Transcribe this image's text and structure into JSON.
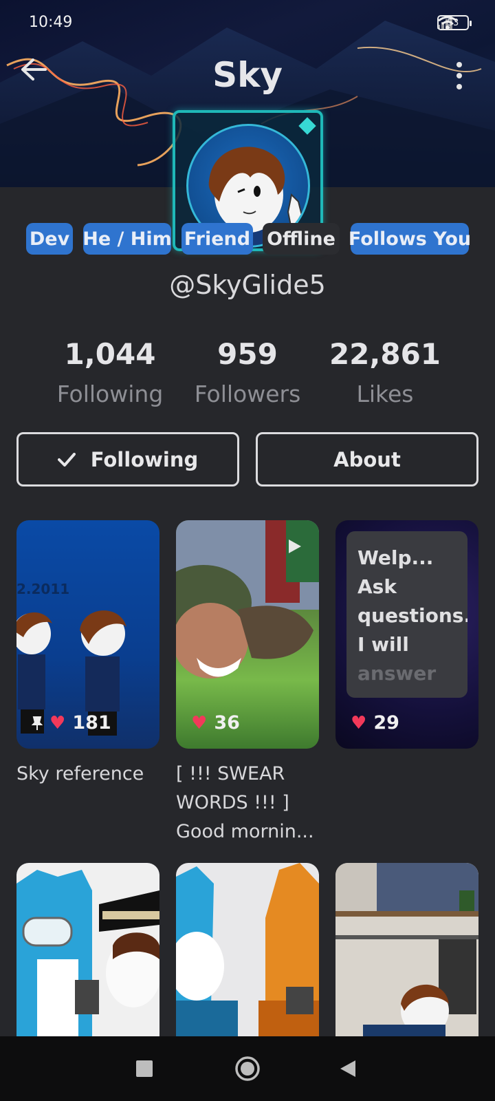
{
  "status_bar": {
    "time": "10:49",
    "battery": "53"
  },
  "header": {
    "title": "Sky"
  },
  "badges": [
    {
      "label": "Dev",
      "style": "blue"
    },
    {
      "label": "He / Him",
      "style": "blue"
    },
    {
      "label": "Friend",
      "style": "blue"
    },
    {
      "label": "Offline",
      "style": "dark"
    },
    {
      "label": "Follows You",
      "style": "blue"
    }
  ],
  "profile": {
    "handle": "@SkyGlide5"
  },
  "stats": [
    {
      "value": "1,044",
      "label": "Following"
    },
    {
      "value": "959",
      "label": "Followers"
    },
    {
      "value": "22,861",
      "label": "Likes"
    }
  ],
  "actions": {
    "following_label": "Following",
    "about_label": "About"
  },
  "posts": [
    {
      "likes": "181",
      "caption": "Sky reference",
      "pinned": true,
      "watermark": "2.2011"
    },
    {
      "likes": "36",
      "caption": "[ !!! SWEAR WORDS !!! ] Good mornin..."
    },
    {
      "likes": "29",
      "caption": "",
      "card_text": "Welp... Ask questions. I will",
      "card_text_fade": "answer"
    },
    {
      "likes": "",
      "caption": ""
    },
    {
      "likes": "",
      "caption": ""
    },
    {
      "likes": "",
      "caption": ""
    }
  ],
  "colors": {
    "accent_blue": "#2f74cf",
    "background": "#26272b",
    "heart": "#f2395a",
    "avatar_border": "#1fb8b8"
  },
  "icons": [
    "back-arrow-icon",
    "more-vertical-icon",
    "checkmark-icon",
    "pin-icon",
    "heart-icon",
    "play-icon",
    "nav-square-icon",
    "nav-home-icon",
    "nav-back-icon"
  ]
}
